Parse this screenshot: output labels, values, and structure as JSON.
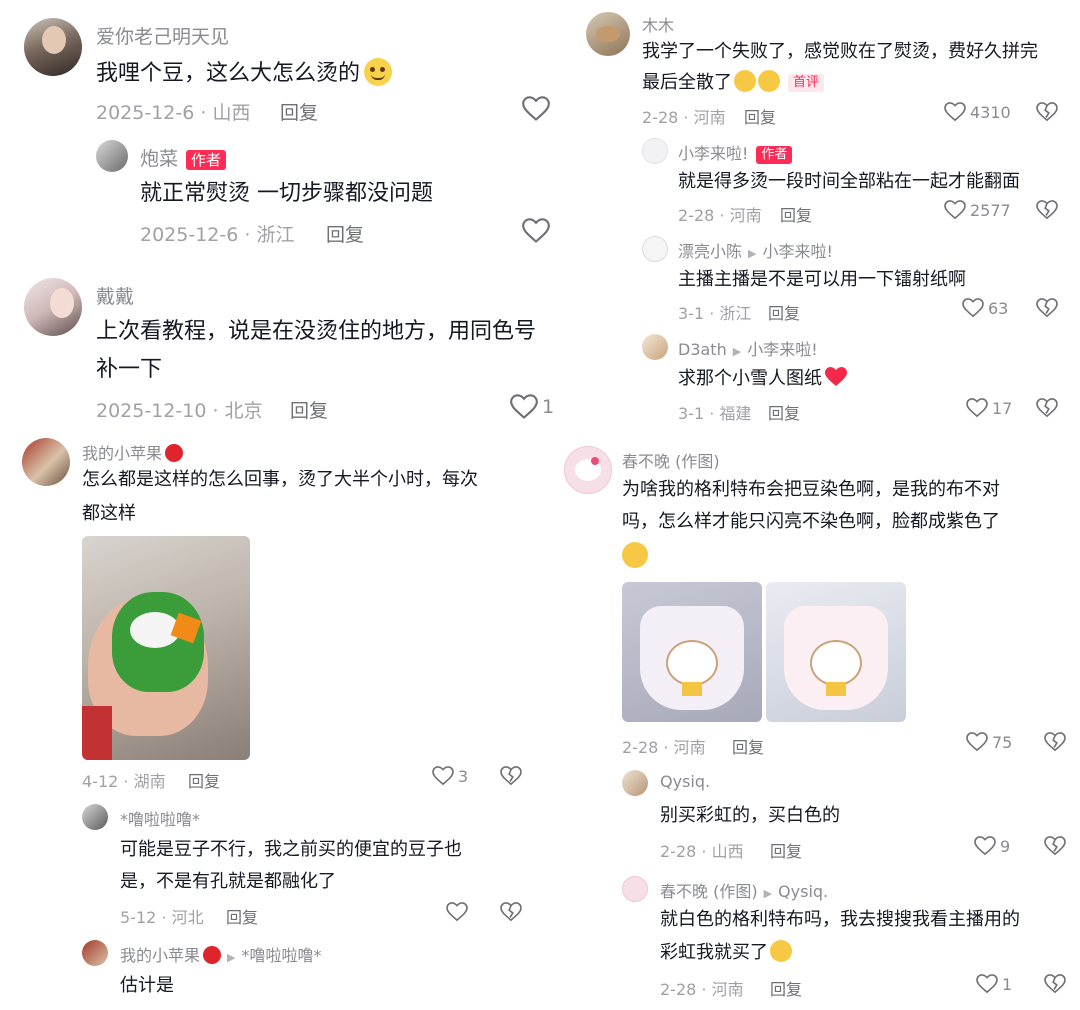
{
  "p1": {
    "c1": {
      "name": "爱你老己明天见",
      "text": "我哩个豆，这么大怎么烫的",
      "date": "2025-12-6 · 山西",
      "reply": "回复"
    },
    "r1": {
      "name": "炮菜",
      "author_tag": "作者",
      "text": "就正常熨烫 一切步骤都没问题",
      "date": "2025-12-6 · 浙江",
      "reply": "回复"
    },
    "c2": {
      "name": "戴戴",
      "text1": "上次看教程，说是在没烫住的地方，用同色号",
      "text2": "补一下",
      "date": "2025-12-10 · 北京",
      "reply": "回复",
      "likes": "1"
    }
  },
  "p2": {
    "c1": {
      "name": "木木",
      "text1": "我学了一个失败了，感觉败在了熨烫，费好久拼完",
      "text2": "最后全散了",
      "first_tag": "首评",
      "date": "2-28 · 河南",
      "reply": "回复",
      "likes": "4310"
    },
    "r1": {
      "name": "小李来啦!",
      "author_tag": "作者",
      "text": "就是得多烫一段时间全部粘在一起才能翻面",
      "date": "2-28 · 河南",
      "reply": "回复",
      "likes": "2577"
    },
    "r2": {
      "name": "漂亮小陈",
      "to": "小李来啦!",
      "text": "主播主播是不是可以用一下镭射纸啊",
      "date": "3-1 · 浙江",
      "reply": "回复",
      "likes": "63"
    },
    "r3": {
      "name": "D3ath",
      "to": "小李来啦!",
      "text": "求那个小雪人图纸",
      "date": "3-1 · 福建",
      "reply": "回复",
      "likes": "17"
    }
  },
  "p3": {
    "c1": {
      "name": "我的小苹果",
      "text1": "怎么都是这样的怎么回事，烫了大半个小时，每次",
      "text2": "都这样",
      "date": "4-12 · 湖南",
      "reply": "回复",
      "likes": "3"
    },
    "r1": {
      "name": "*噜啦啦噜*",
      "text1": "可能是豆子不行，我之前买的便宜的豆子也",
      "text2": "是，不是有孔就是都融化了",
      "date": "5-12 · 河北",
      "reply": "回复"
    },
    "r2": {
      "name": "我的小苹果",
      "to": "*噜啦啦噜*",
      "text": "估计是"
    }
  },
  "p4": {
    "c1": {
      "name": "春不晚 (作图)",
      "text1": "为啥我的格利特布会把豆染色啊，是我的布不对",
      "text2": "吗，怎么样才能只闪亮不染色啊，脸都成紫色了",
      "date": "2-28 · 河南",
      "reply": "回复",
      "likes": "75"
    },
    "r1": {
      "name": "Qysiq.",
      "text": "别买彩虹的，买白色的",
      "date": "2-28 · 山西",
      "reply": "回复",
      "likes": "9"
    },
    "r2": {
      "name": "春不晚 (作图)",
      "to": "Qysiq.",
      "text1": "就白色的格利特布吗，我去搜搜我看主播用的",
      "text2": "彩虹我就买了",
      "date": "2-28 · 河南",
      "reply": "回复",
      "likes": "1"
    }
  },
  "colors": {
    "accent": "#fe2c55",
    "text": "#161823",
    "muted": "#8a8b91"
  }
}
